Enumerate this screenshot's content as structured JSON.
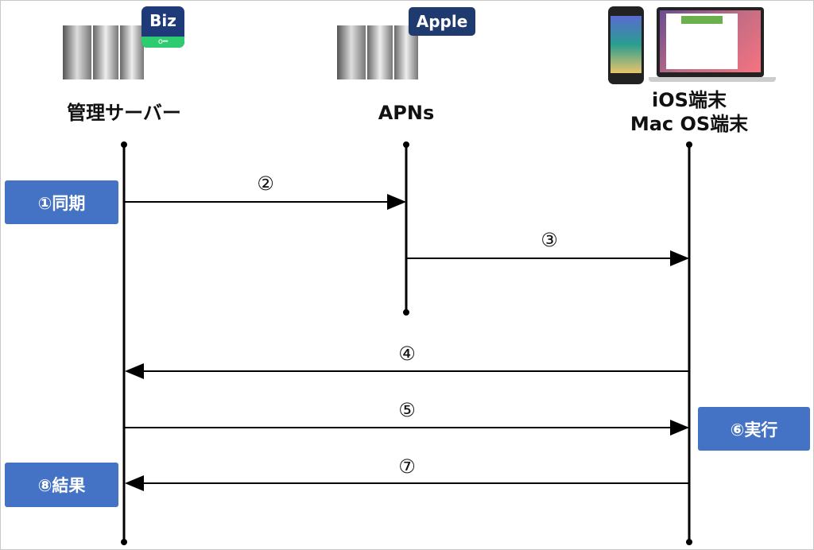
{
  "actors": [
    {
      "label": "管理サーバー",
      "badge": "Biz"
    },
    {
      "label": "APNs",
      "badge": "Apple"
    },
    {
      "label": "iOS端末",
      "label2": "Mac OS端末"
    }
  ],
  "steps": {
    "s1": "①同期",
    "s2": "②",
    "s3": "③",
    "s4": "④",
    "s5": "⑤",
    "s6": "⑥実行",
    "s7": "⑦",
    "s8": "⑧結果"
  },
  "colors": {
    "box": "#4472C4",
    "biz": "#1e3a78",
    "biz_key": "#2ecc71",
    "apple": "#1e3a6e"
  }
}
